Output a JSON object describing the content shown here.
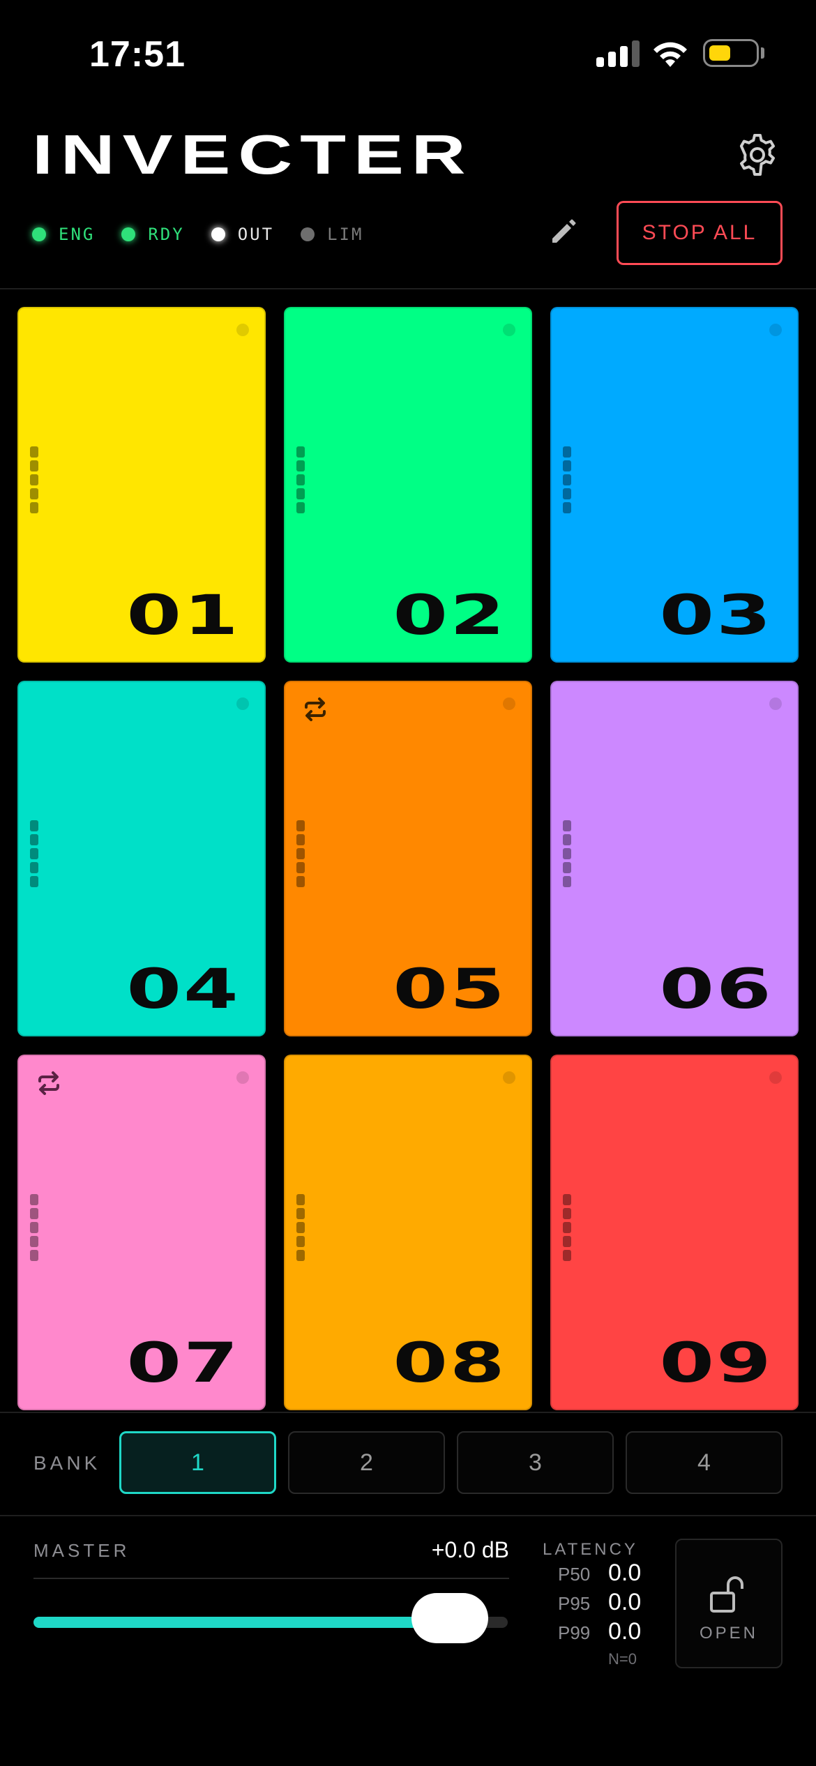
{
  "status_bar": {
    "time": "17:51"
  },
  "header": {
    "title": "INVECTER",
    "indicators": [
      {
        "label": "ENG",
        "dot_color": "#2fe07a",
        "text_color": "#2fe07a"
      },
      {
        "label": "RDY",
        "dot_color": "#2fe07a",
        "text_color": "#2fe07a"
      },
      {
        "label": "OUT",
        "dot_color": "#ffffff",
        "text_color": "#e8e8e8"
      },
      {
        "label": "LIM",
        "dot_color": "#6e6e6e",
        "text_color": "#7a7a7a"
      }
    ],
    "stop_all_label": "STOP ALL"
  },
  "pads": [
    {
      "number": "01",
      "color": "#ffe600",
      "loop": false
    },
    {
      "number": "02",
      "color": "#00ff85",
      "loop": false
    },
    {
      "number": "03",
      "color": "#00aaff",
      "loop": false
    },
    {
      "number": "04",
      "color": "#00e0c8",
      "loop": false
    },
    {
      "number": "05",
      "color": "#ff8800",
      "loop": true
    },
    {
      "number": "06",
      "color": "#cc88ff",
      "loop": false
    },
    {
      "number": "07",
      "color": "#ff88cc",
      "loop": true
    },
    {
      "number": "08",
      "color": "#ffaa00",
      "loop": false
    },
    {
      "number": "09",
      "color": "#ff4444",
      "loop": false
    }
  ],
  "bank": {
    "label": "BANK",
    "options": [
      "1",
      "2",
      "3",
      "4"
    ],
    "selected": "1"
  },
  "master": {
    "label": "MASTER",
    "value": "+0.0 dB",
    "level_fraction": 0.95
  },
  "latency": {
    "title": "LATENCY",
    "rows": [
      {
        "key": "P50",
        "value": "0.0"
      },
      {
        "key": "P95",
        "value": "0.0"
      },
      {
        "key": "P99",
        "value": "0.0"
      }
    ],
    "count": "N=0"
  },
  "lock": {
    "label": "OPEN"
  },
  "colors": {
    "accent": "#1fd8c7",
    "danger": "#ff4b55",
    "background": "#000000"
  }
}
